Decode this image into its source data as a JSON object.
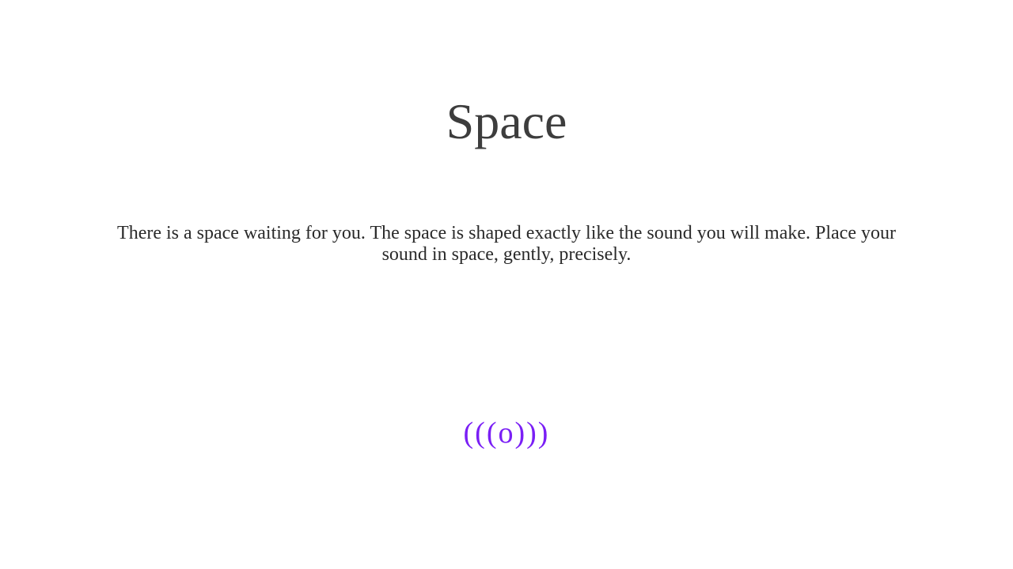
{
  "page": {
    "title": "Space",
    "prompt": "There is a space waiting for you. The space is shaped exactly like the sound you will make. Place your sound in space, gently, precisely.",
    "record_button": {
      "label": "(((o)))",
      "icon": "broadcast-icon",
      "color": "#7a1ff5"
    }
  },
  "colors": {
    "background": "#ffffff",
    "title": "#3d3d3d",
    "text": "#2a2a2a",
    "accent": "#7a1ff5"
  }
}
